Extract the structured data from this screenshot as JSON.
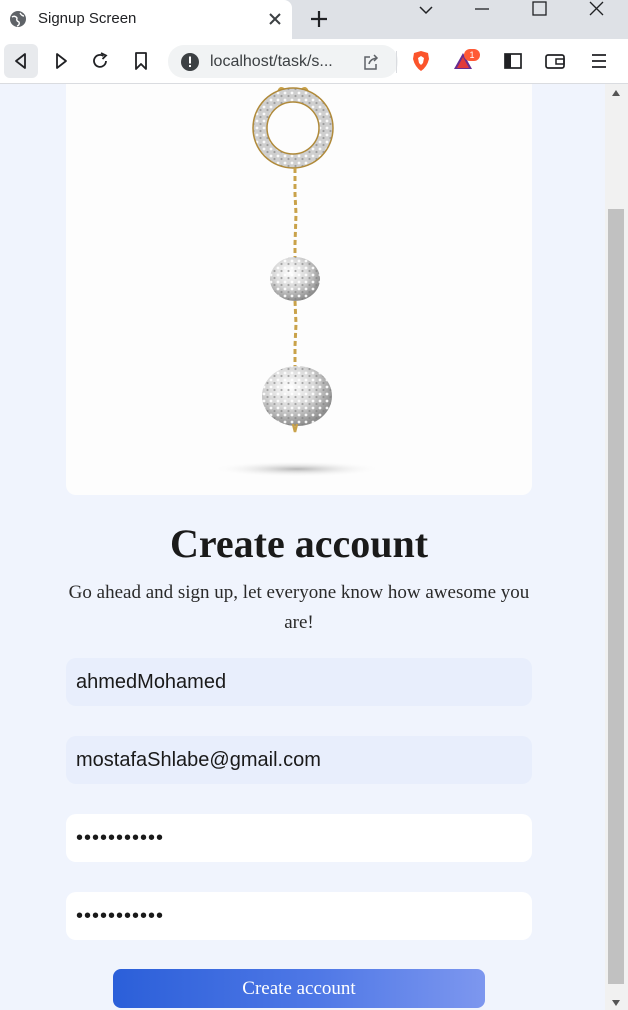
{
  "browser": {
    "tab_title": "Signup Screen",
    "url": "localhost/task/s...",
    "notification_count": "1"
  },
  "page": {
    "title": "Create account",
    "subtitle": "Go ahead and sign up, let everyone know how awesome you are!",
    "fields": {
      "username_value": "ahmedMohamed",
      "email_value": "mostafaShlabe@gmail.com",
      "password_value": "passwordabc",
      "confirm_password_value": "passwordabc"
    },
    "submit_label": "Create account"
  },
  "colors": {
    "accent": "#2b5fd9",
    "page_background": "#f0f4fd",
    "filled_field": "#e8eefc"
  }
}
